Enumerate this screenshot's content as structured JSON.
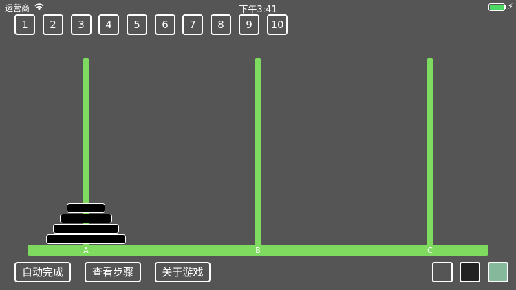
{
  "status": {
    "carrier": "运营商",
    "time": "下午3:41",
    "battery_level": 1.0,
    "battery_color": "#4cd964"
  },
  "levels": [
    "1",
    "2",
    "3",
    "4",
    "5",
    "6",
    "7",
    "8",
    "9",
    "10"
  ],
  "game": {
    "peg_color": "#7fdb5f",
    "pegs": [
      {
        "label": "A",
        "disks": [
          4,
          3,
          2,
          1
        ]
      },
      {
        "label": "B",
        "disks": []
      },
      {
        "label": "C",
        "disks": []
      }
    ]
  },
  "actions": {
    "auto_complete": "自动完成",
    "view_steps": "查看步骤",
    "about": "关于游戏"
  },
  "color_swatches": [
    "#555555",
    "#222222",
    "#86b89c"
  ]
}
